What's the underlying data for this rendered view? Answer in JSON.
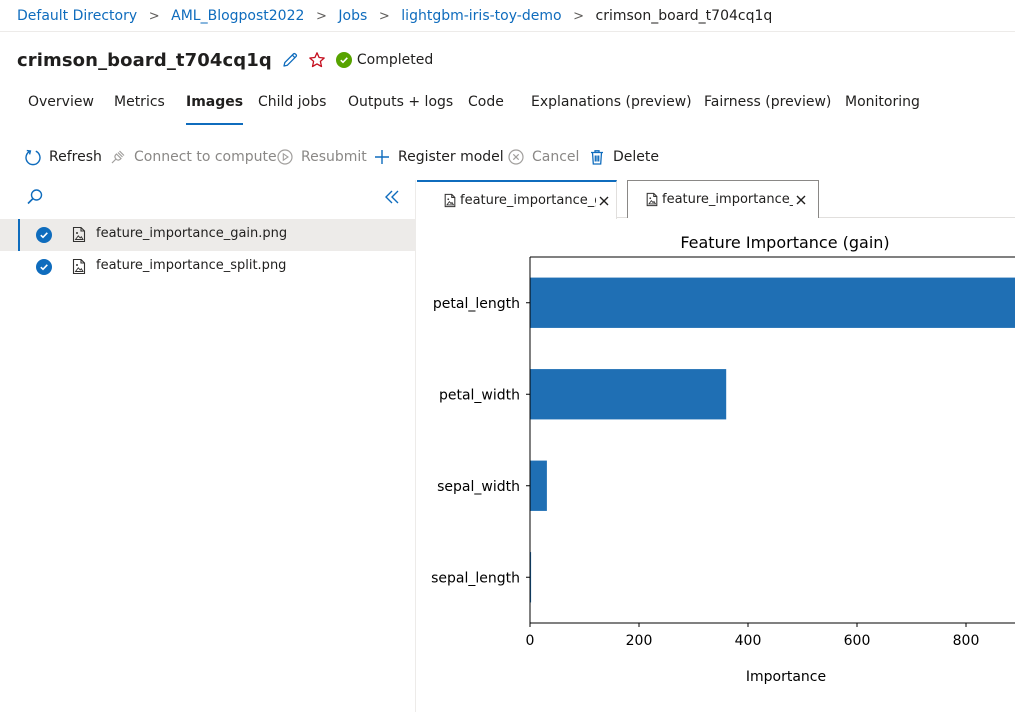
{
  "breadcrumb": {
    "items": [
      "Default Directory",
      "AML_Blogpost2022",
      "Jobs",
      "lightgbm-iris-toy-demo",
      "crimson_board_t704cq1q"
    ],
    "separator": ">"
  },
  "header": {
    "title": "crimson_board_t704cq1q",
    "status": "Completed",
    "status_color": "#57a300",
    "edit_icon": "pencil-icon",
    "favorite_icon": "star-icon"
  },
  "tabs": [
    {
      "label": "Overview"
    },
    {
      "label": "Metrics"
    },
    {
      "label": "Images",
      "active": true
    },
    {
      "label": "Child jobs"
    },
    {
      "label": "Outputs + logs"
    },
    {
      "label": "Code"
    },
    {
      "label": "Explanations (preview)"
    },
    {
      "label": "Fairness (preview)"
    },
    {
      "label": "Monitoring"
    }
  ],
  "toolbar": {
    "refresh": "Refresh",
    "connect": "Connect to compute",
    "resubmit": "Resubmit",
    "register": "Register model",
    "cancel": "Cancel",
    "delete": "Delete"
  },
  "files": [
    {
      "name": "feature_importance_gain.png",
      "selected": true
    },
    {
      "name": "feature_importance_split.png",
      "selected": false
    }
  ],
  "image_tabs": [
    {
      "label": "feature_importance_gain.png",
      "active": true
    },
    {
      "label": "feature_importance_split.png",
      "active": false
    }
  ],
  "colors": {
    "accent": "#0f6cbd",
    "bar": "#1f6fb4",
    "success": "#57a300",
    "favorite": "#c50f1f"
  },
  "chart_data": {
    "type": "bar",
    "orientation": "horizontal",
    "title": "Feature Importance (gain)",
    "xlabel": "Importance",
    "ylabel": "",
    "categories": [
      "petal_length",
      "petal_width",
      "sepal_width",
      "sepal_length"
    ],
    "values": [
      910,
      360,
      31,
      2
    ],
    "xticks": [
      0,
      200,
      400,
      600,
      800
    ],
    "xlim": [
      0,
      880
    ],
    "grid": false
  }
}
